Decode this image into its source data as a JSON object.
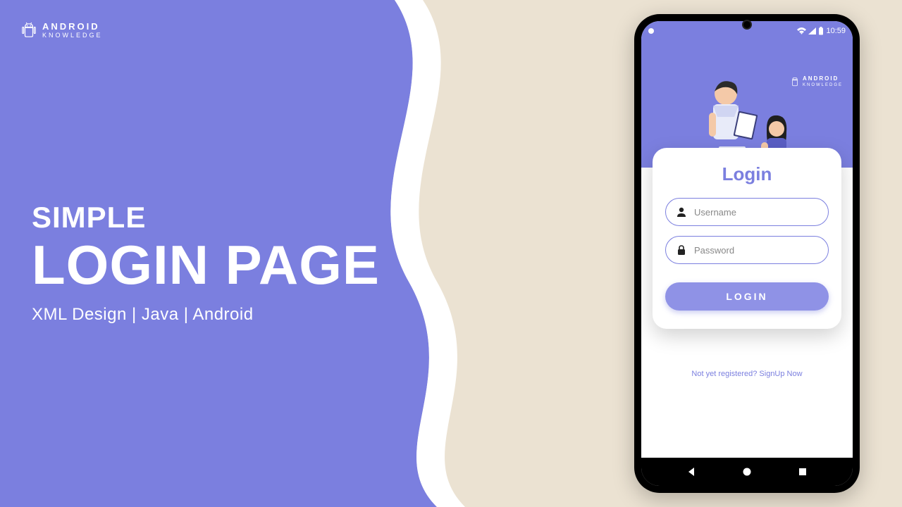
{
  "brand": {
    "line1": "ANDROID",
    "line2": "KNOWLEDGE"
  },
  "headline": {
    "small": "SIMPLE",
    "big": "LOGIN PAGE",
    "sub": "XML Design | Java | Android"
  },
  "status": {
    "time": "10:59"
  },
  "login": {
    "title": "Login",
    "username_placeholder": "Username",
    "password_placeholder": "Password",
    "button_label": "LOGIN",
    "signup_text": "Not yet registered? SignUp Now"
  },
  "colors": {
    "accent": "#7b7fdf",
    "background": "#ebe2d2"
  }
}
